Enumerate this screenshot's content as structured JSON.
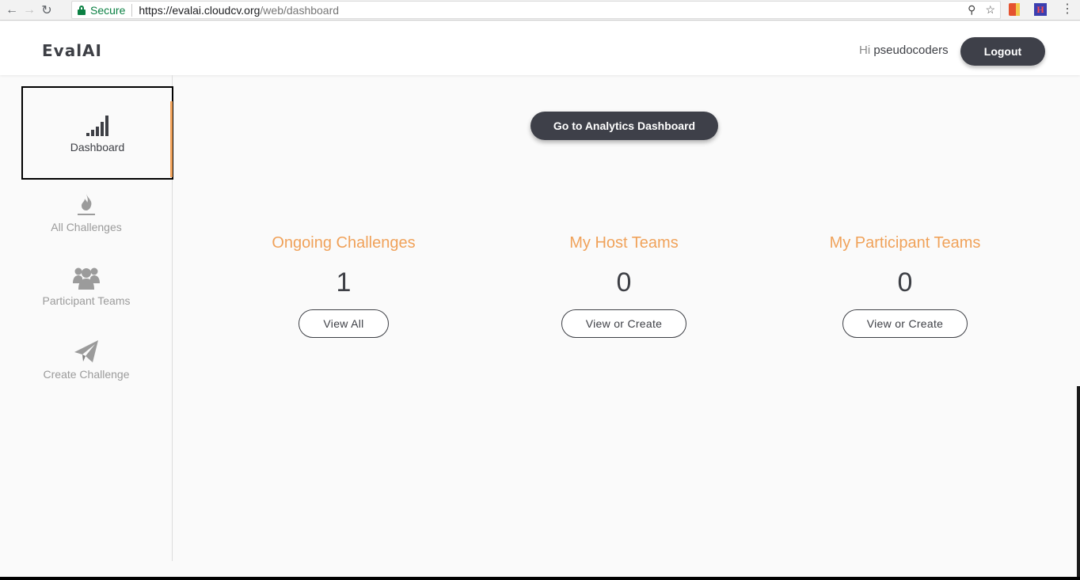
{
  "browser": {
    "secure_label": "Secure",
    "url_host": "https://evalai.cloudcv.org",
    "url_path": "/web/dashboard",
    "ext2_label": "H"
  },
  "header": {
    "logo": "EvalAI",
    "greeting_prefix": "Hi",
    "username": "pseudocoders",
    "logout_label": "Logout"
  },
  "sidebar": {
    "items": [
      {
        "label": "Dashboard",
        "icon": "bar-signal-icon",
        "active": true
      },
      {
        "label": "All Challenges",
        "icon": "flame-icon"
      },
      {
        "label": "Participant Teams",
        "icon": "users-icon"
      },
      {
        "label": "Create Challenge",
        "icon": "paper-plane-icon"
      }
    ]
  },
  "main": {
    "analytics_button": "Go to Analytics Dashboard",
    "stats": [
      {
        "title": "Ongoing Challenges",
        "value": "1",
        "button": "View All"
      },
      {
        "title": "My Host Teams",
        "value": "0",
        "button": "View or Create"
      },
      {
        "title": "My Participant Teams",
        "value": "0",
        "button": "View or Create"
      }
    ]
  },
  "colors": {
    "accent": "#f0a25a",
    "dark": "#3e4049",
    "secure_green": "#0b8043"
  }
}
